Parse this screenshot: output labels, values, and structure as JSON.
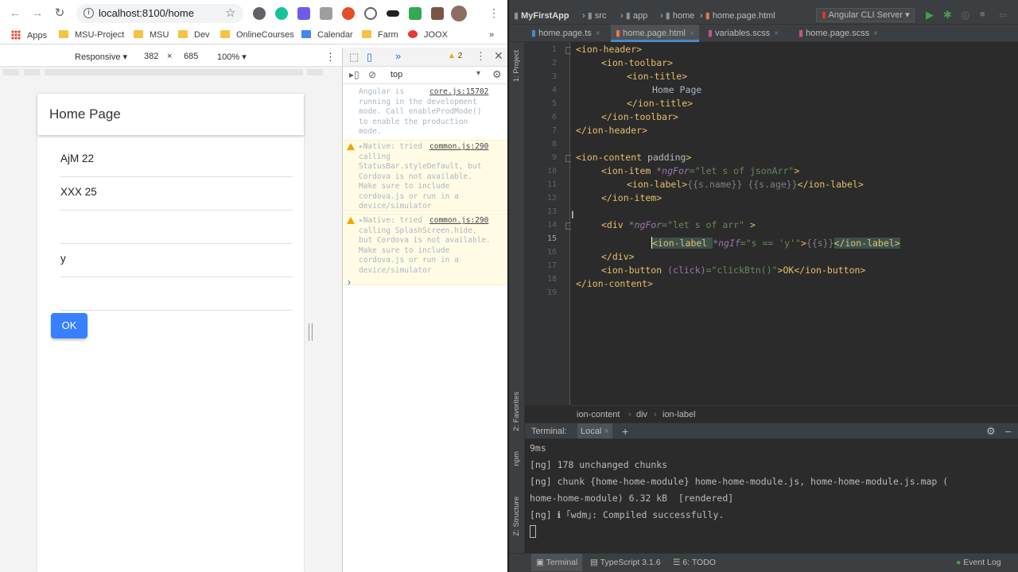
{
  "browser": {
    "url": "localhost:8100/home",
    "bookmarks": [
      "Apps",
      "MSU-Project",
      "MSU",
      "Dev",
      "OnlineCourses",
      "Calendar",
      "Farm",
      "JOOX"
    ],
    "bookmark_more": "»",
    "device_toolbar": {
      "mode": "Responsive",
      "width": "382",
      "times": "×",
      "height": "685",
      "zoom": "100%"
    }
  },
  "app": {
    "title": "Home Page",
    "items": [
      "AjM 22",
      "XXX 25",
      "",
      "y",
      ""
    ],
    "ok_label": "OK"
  },
  "devtools": {
    "warning_count": "2",
    "context": "top",
    "messages": [
      {
        "type": "info",
        "text": "Angular is\nrunning in the development\nmode. Call enableProdMode()\nto enable the production\nmode.",
        "source": "core.js:15702"
      },
      {
        "type": "warn",
        "text": "▸Native: tried\ncalling\nStatusBar.styleDefault, but\nCordova is not available.\nMake sure to include\ncordova.js or run in a\ndevice/simulator",
        "source": "common.js:290"
      },
      {
        "type": "warn",
        "text": "▸Native: tried\ncalling SplashScreen.hide,\nbut Cordova is not available.\nMake sure to include\ncordova.js or run in a\ndevice/simulator",
        "source": "common.js:290"
      }
    ],
    "prompt": "›"
  },
  "ide": {
    "nav": {
      "project": "MyFirstApp",
      "crumbs": [
        "src",
        "app",
        "home",
        "home.page.html"
      ],
      "run_config": "Angular CLI Server"
    },
    "tabs": [
      "home.page.ts",
      "home.page.html",
      "variables.scss",
      "home.page.scss"
    ],
    "active_tab": "home.page.html",
    "side_labels": {
      "project": "1: Project",
      "favorites": "2: Favorites",
      "npm": "npm",
      "structure": "Z: Structure"
    },
    "line_numbers": [
      "1",
      "2",
      "3",
      "4",
      "5",
      "6",
      "7",
      "8",
      "9",
      "10",
      "11",
      "12",
      "13",
      "14",
      "15",
      "16",
      "17",
      "18",
      "19"
    ],
    "breadcrumbs": [
      "ion-content",
      "div",
      "ion-label"
    ],
    "terminal": {
      "title": "Terminal:",
      "session": "Local",
      "lines": [
        "9ms",
        "[ng] 178 unchanged chunks",
        "[ng] chunk {home-home-module} home-home-module.js, home-home-module.js.map (",
        "home-home-module) 6.32 kB  [rendered]",
        "[ng] ℹ ｢wdm｣: Compiled successfully."
      ]
    },
    "status_bar": {
      "terminal": "Terminal",
      "typescript": "TypeScript 3.1.6",
      "todo": "6: TODO",
      "event_log": "Event Log"
    },
    "code": {
      "l1": "<ion-header>",
      "l2": "<ion-toolbar>",
      "l3": "<ion-title>",
      "l4": "Home Page",
      "l5": "</ion-title>",
      "l6": "</ion-toolbar>",
      "l7": "</ion-header>",
      "l9a": "<ion-content ",
      "l9b": "padding",
      "l9c": ">",
      "l10a": "<ion-item ",
      "l10b": "*ngFor",
      "l10c": "=\"let s of jsonArr\"",
      "l10d": ">",
      "l11a": "<ion-label>",
      "l11b": "{{s.name}} {{s.age}}",
      "l11c": "</ion-label>",
      "l12": "</ion-item>",
      "l14a": "<div ",
      "l14b": "*ngFor",
      "l14c": "=\"let s of arr\"",
      "l14d": " >",
      "l15a": "<ion-label ",
      "l15b": "*ngIf",
      "l15c": "=\"s == 'y'\"",
      "l15d": ">",
      "l15e": "{{s}}",
      "l15f": "</ion-label>",
      "l16": "</div>",
      "l17a": "<ion-button ",
      "l17b": "(click)",
      "l17c": "=\"clickBtn()\"",
      "l17d": ">OK</ion-button>",
      "l18": "</ion-content>"
    }
  }
}
